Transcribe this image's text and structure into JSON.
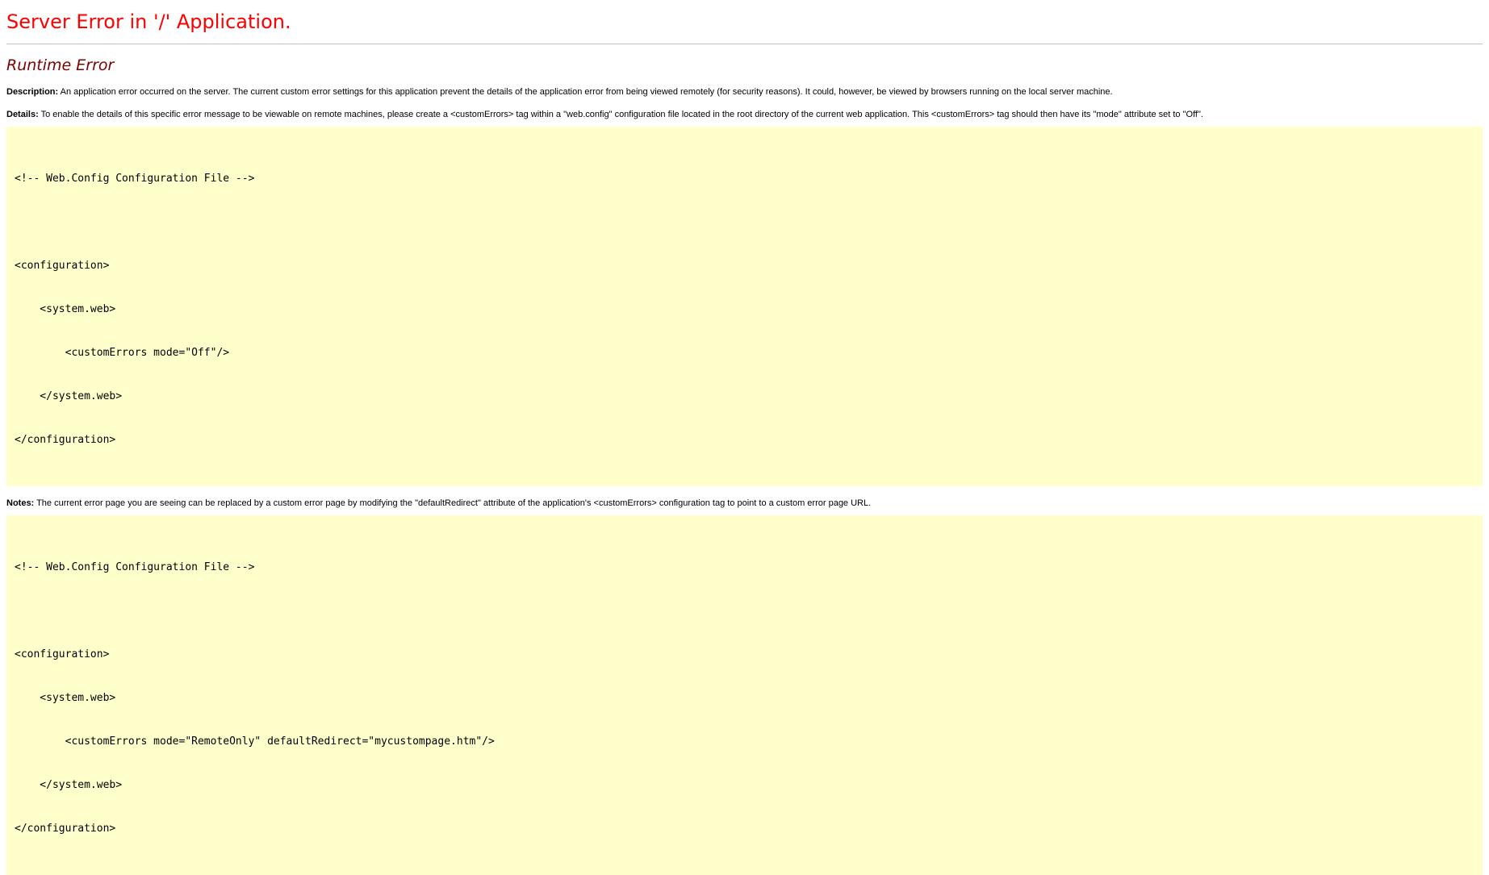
{
  "title": "Server Error in '/' Application.",
  "subtitle": "Runtime Error",
  "description": {
    "label": "Description:",
    "text": " An application error occurred on the server. The current custom error settings for this application prevent the details of the application error from being viewed remotely (for security reasons). It could, however, be viewed by browsers running on the local server machine."
  },
  "details": {
    "label": "Details:",
    "text": " To enable the details of this specific error message to be viewable on remote machines, please create a <customErrors> tag within a \"web.config\" configuration file located in the root directory of the current web application. This <customErrors> tag should then have its \"mode\" attribute set to \"Off\"."
  },
  "code1": [
    "<!-- Web.Config Configuration File -->",
    "",
    "<configuration>",
    "    <system.web>",
    "        <customErrors mode=\"Off\"/>",
    "    </system.web>",
    "</configuration>"
  ],
  "notes": {
    "label": "Notes:",
    "text": " The current error page you are seeing can be replaced by a custom error page by modifying the \"defaultRedirect\" attribute of the application's <customErrors> configuration tag to point to a custom error page URL."
  },
  "code2": [
    "<!-- Web.Config Configuration File -->",
    "",
    "<configuration>",
    "    <system.web>",
    "        <customErrors mode=\"RemoteOnly\" defaultRedirect=\"mycustompage.htm\"/>",
    "    </system.web>",
    "</configuration>"
  ]
}
